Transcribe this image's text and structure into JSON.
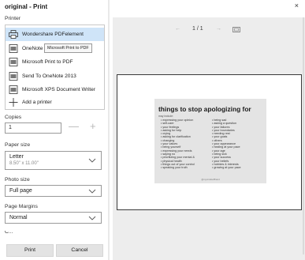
{
  "window": {
    "title": "original - Print",
    "close_glyph": "×"
  },
  "printer": {
    "label": "Printer",
    "items": [
      {
        "label": "Wondershare PDFelement",
        "icon": "printer-icon",
        "selected": true
      },
      {
        "label": "OneNote",
        "icon": "printer-icon",
        "selected": false
      },
      {
        "label": "Microsoft Print to PDF",
        "icon": "printer-icon",
        "selected": false
      },
      {
        "label": "Send To OneNote 2013",
        "icon": "printer-icon",
        "selected": false
      },
      {
        "label": "Microsoft XPS Document Writer",
        "icon": "printer-icon",
        "selected": false
      },
      {
        "label": "Add a printer",
        "icon": "plus-icon",
        "selected": false
      }
    ],
    "tooltip": "Microsoft Print to PDF"
  },
  "copies": {
    "label": "Copies",
    "value": "1",
    "minus": "—",
    "plus": "+"
  },
  "paper_size": {
    "label": "Paper size",
    "value": "Letter",
    "detail": "8.50\" x 11.00\""
  },
  "photo_size": {
    "label": "Photo size",
    "value": "Full page"
  },
  "margins": {
    "label": "Page Margins",
    "value": "Normal"
  },
  "cut_label": "C...",
  "buttons": {
    "print": "Print",
    "cancel": "Cancel"
  },
  "preview": {
    "prev": "←",
    "next": "→",
    "page_indicator": "1 / 1",
    "card": {
      "title": "things to stop apologizing for",
      "subtitle": "may include:",
      "col1": [
        "expressing your opinion",
        "self-care",
        "your feelings",
        "asking for help",
        "crying",
        "asking for clarification",
        "changing",
        "your values",
        "being yourself",
        "expressing your needs",
        "saying no",
        "prioritizing your mental &",
        "physical health",
        "things out of your control",
        "speaking your truth"
      ],
      "col2": [
        "being sad",
        "asking a question",
        "your failures",
        "your boundaries",
        "needing rest",
        "your goals",
        "others",
        "your appearance",
        "healing at your pace",
        "your age",
        "being sick",
        "your success",
        "your beliefs",
        "hobbies & interests",
        "growing at your pace"
      ],
      "footer": "@mymindsoffhand"
    }
  },
  "colors": {
    "selected": "#cfe4f8",
    "preview_bg": "#ededed",
    "card_bg": "#e4e4e4"
  }
}
